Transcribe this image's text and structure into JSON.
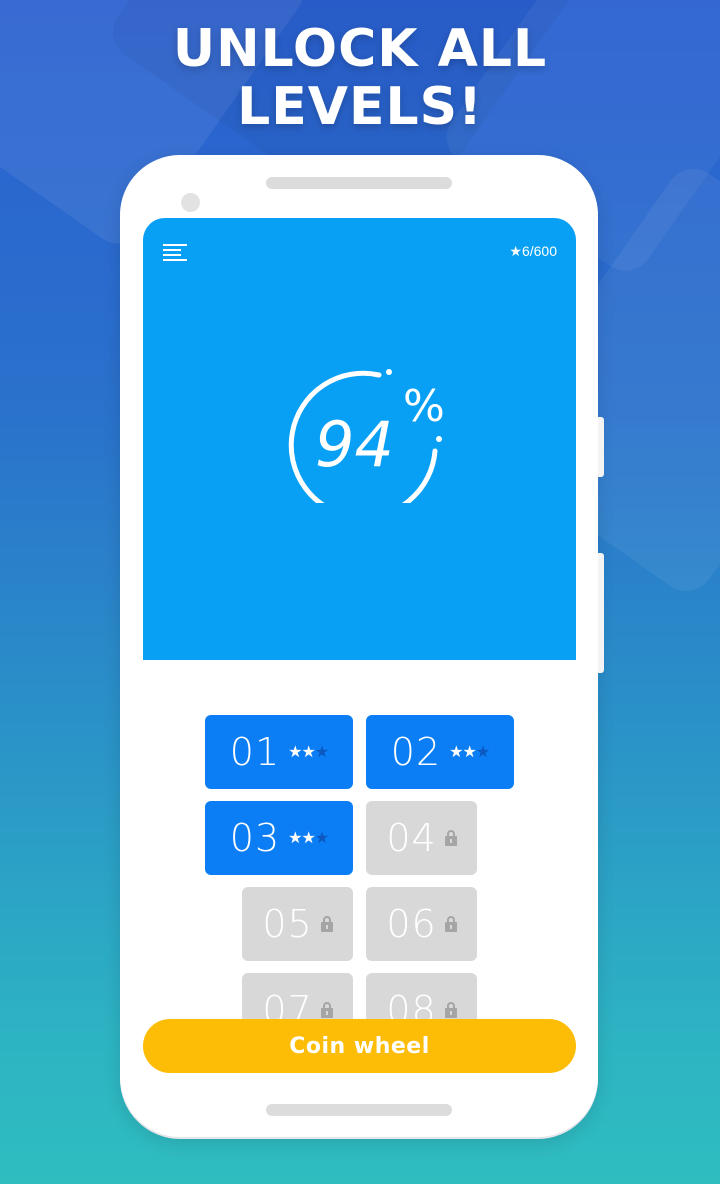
{
  "headline": {
    "line1": "UNLOCK ALL",
    "line2": "LEVELS!"
  },
  "app": {
    "menu_icon": "hamburger-menu-icon",
    "score": "★6/600",
    "logo": {
      "number": "94",
      "symbol": "%"
    },
    "levels": [
      {
        "num": "01",
        "locked": false,
        "stars_earned": 2,
        "stars_total": 3
      },
      {
        "num": "02",
        "locked": false,
        "stars_earned": 2,
        "stars_total": 3
      },
      {
        "num": "03",
        "locked": false,
        "stars_earned": 2,
        "stars_total": 3
      },
      {
        "num": "04",
        "locked": true,
        "icon": "lock-icon"
      },
      {
        "num": "05",
        "locked": true,
        "icon": "lock-icon"
      },
      {
        "num": "06",
        "locked": true,
        "icon": "lock-icon"
      },
      {
        "num": "07",
        "locked": true,
        "icon": "lock-icon"
      },
      {
        "num": "08",
        "locked": true,
        "icon": "lock-icon"
      }
    ],
    "coin_wheel_label": "Coin wheel"
  },
  "colors": {
    "hero_blue": "#08a0f4",
    "level_blue": "#0b7ef5",
    "locked_gray": "#d8d8d8",
    "coin_yellow": "#fdbc05"
  }
}
